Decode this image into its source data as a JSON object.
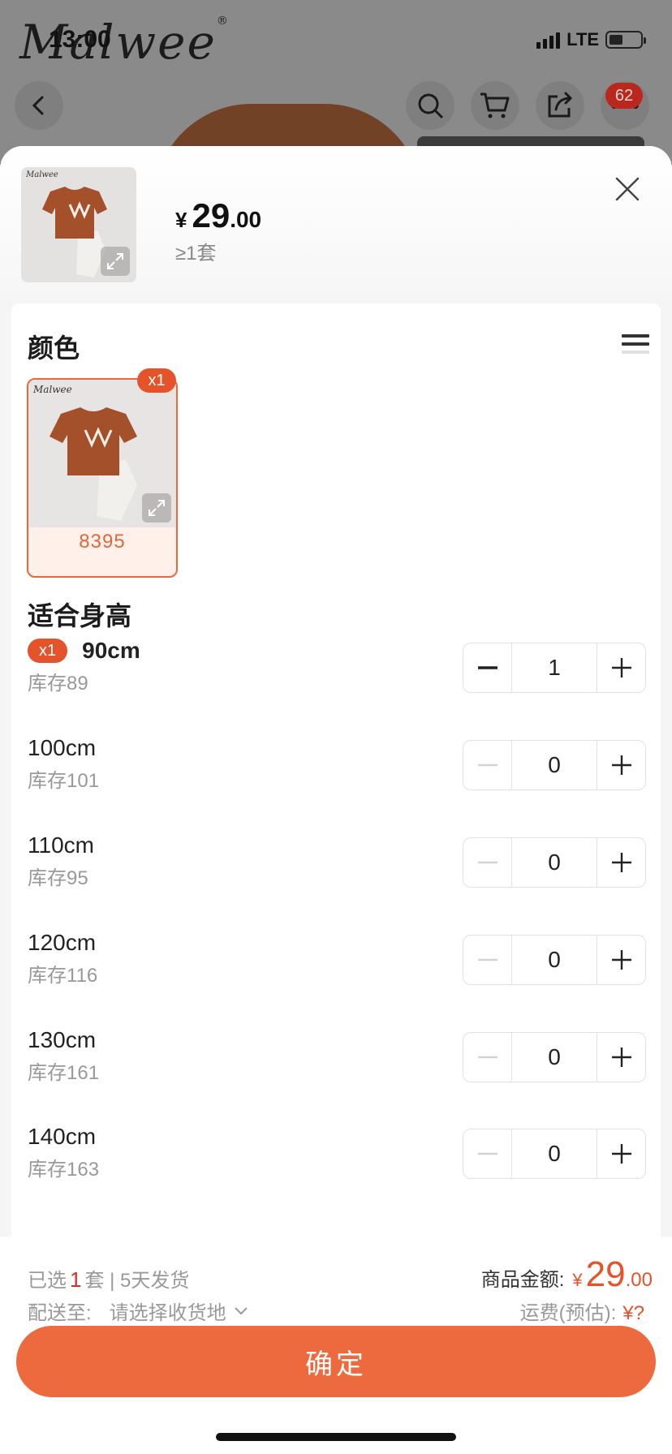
{
  "status_bar": {
    "time": "13:00",
    "network": "LTE"
  },
  "background": {
    "brand_logo": "Malwee",
    "cart_badge": "62"
  },
  "product": {
    "price_symbol": "¥",
    "price_integer": "29",
    "price_decimal": ".00",
    "min_qty": "≥1套"
  },
  "color_section": {
    "title": "颜色",
    "options": [
      {
        "label": "8395",
        "count_badge": "x1"
      }
    ]
  },
  "size_section": {
    "title": "适合身高",
    "rows": [
      {
        "name": "90cm",
        "stock": "库存89",
        "qty": "1",
        "badge": "x1"
      },
      {
        "name": "100cm",
        "stock": "库存101",
        "qty": "0"
      },
      {
        "name": "110cm",
        "stock": "库存95",
        "qty": "0"
      },
      {
        "name": "120cm",
        "stock": "库存116",
        "qty": "0"
      },
      {
        "name": "130cm",
        "stock": "库存161",
        "qty": "0"
      },
      {
        "name": "140cm",
        "stock": "库存163",
        "qty": "0"
      }
    ]
  },
  "footer": {
    "selected_prefix": "已选",
    "selected_count": "1",
    "selected_suffix": "套 | 5天发货",
    "ship_label": "配送至:",
    "ship_placeholder": "请选择收货地",
    "total_label": "商品金额:",
    "total_symbol": "¥",
    "total_integer": "29",
    "total_decimal": ".00",
    "freight_label": "运费(预估):",
    "freight_value": "¥?",
    "confirm_label": "确定"
  },
  "colors": {
    "accent": "#ec6a3e",
    "badge": "#e5532a",
    "price_red": "#d9301f",
    "shirt": "#a4502a"
  }
}
